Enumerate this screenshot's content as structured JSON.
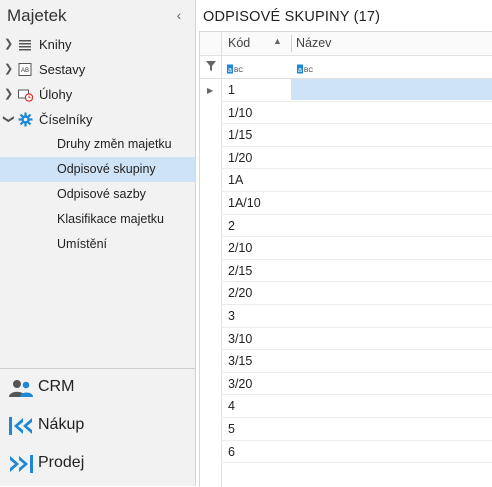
{
  "sidebar": {
    "title": "Majetek",
    "collapse_icon": "chevron-left-icon",
    "tree": [
      {
        "label": "Knihy",
        "icon": "list-icon",
        "expanded": false
      },
      {
        "label": "Sestavy",
        "icon": "report-icon",
        "expanded": false
      },
      {
        "label": "Úlohy",
        "icon": "task-clock-icon",
        "expanded": false
      },
      {
        "label": "Číselníky",
        "icon": "gear-icon",
        "expanded": true
      }
    ],
    "subitems": [
      {
        "label": "Druhy změn majetku"
      },
      {
        "label": "Odpisové skupiny",
        "selected": true
      },
      {
        "label": "Odpisové sazby"
      },
      {
        "label": "Klasifikace majetku"
      },
      {
        "label": "Umístění"
      }
    ],
    "modules": [
      {
        "label": "CRM",
        "icon": "people-icon"
      },
      {
        "label": "Nákup",
        "icon": "purchase-icon"
      },
      {
        "label": "Prodej",
        "icon": "sale-icon"
      }
    ]
  },
  "main": {
    "title": "ODPISOVÉ SKUPINY (17)",
    "columns": {
      "kod": "Kód",
      "nazev": "Název"
    },
    "filter_badge": "BC",
    "rows": [
      "1",
      "1/10",
      "1/15",
      "1/20",
      "1A",
      "1A/10",
      "2",
      "2/10",
      "2/15",
      "2/20",
      "3",
      "3/10",
      "3/15",
      "3/20",
      "4",
      "5",
      "6"
    ]
  },
  "colors": {
    "accent": "#1e88d6",
    "selection": "#cfe3f6"
  }
}
